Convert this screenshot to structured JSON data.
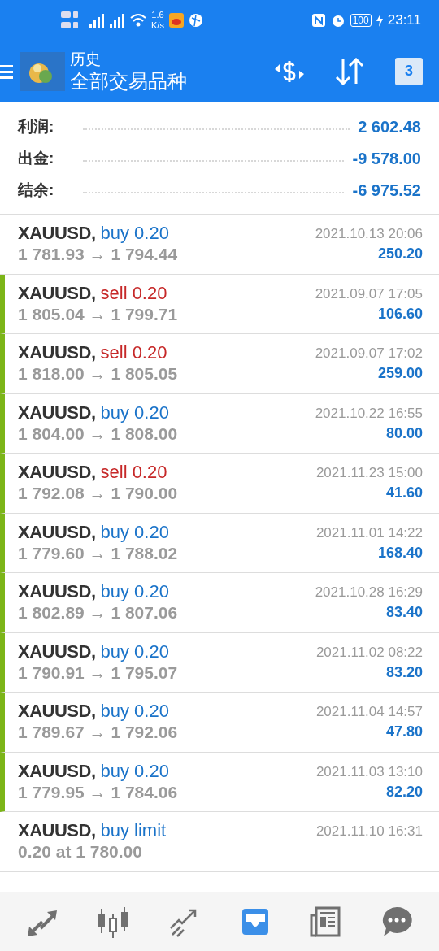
{
  "status_bar": {
    "network_speed": "1.6",
    "network_unit": "K/s",
    "battery": "100",
    "time": "23:11"
  },
  "header": {
    "title": "历史",
    "subtitle": "全部交易品种",
    "calendar_day": "3"
  },
  "summary": [
    {
      "label": "利润:",
      "value": "2 602.48"
    },
    {
      "label": "出金:",
      "value": "-9 578.00"
    },
    {
      "label": "结余:",
      "value": "-6 975.52"
    }
  ],
  "deals": [
    {
      "kind": "deal",
      "symbol": "XAUUSD,",
      "color": "#1a73c9",
      "action": "buy 0.20",
      "prices": "1 781.93 → 1 794.44",
      "time": "2021.10.13 20:06",
      "profit": "250.20",
      "marked": false
    },
    {
      "kind": "deal",
      "symbol": "XAUUSD,",
      "color": "#c62828",
      "action": "sell 0.20",
      "prices": "1 805.04 → 1 799.71",
      "time": "2021.09.07 17:05",
      "profit": "106.60",
      "marked": true
    },
    {
      "kind": "deal",
      "symbol": "XAUUSD,",
      "color": "#c62828",
      "action": "sell 0.20",
      "prices": "1 818.00 → 1 805.05",
      "time": "2021.09.07 17:02",
      "profit": "259.00",
      "marked": true
    },
    {
      "kind": "deal",
      "symbol": "XAUUSD,",
      "color": "#1a73c9",
      "action": "buy 0.20",
      "prices": "1 804.00 → 1 808.00",
      "time": "2021.10.22 16:55",
      "profit": "80.00",
      "marked": true
    },
    {
      "kind": "deal",
      "symbol": "XAUUSD,",
      "color": "#c62828",
      "action": "sell 0.20",
      "prices": "1 792.08 → 1 790.00",
      "time": "2021.11.23 15:00",
      "profit": "41.60",
      "marked": true
    },
    {
      "kind": "deal",
      "symbol": "XAUUSD,",
      "color": "#1a73c9",
      "action": "buy 0.20",
      "prices": "1 779.60 → 1 788.02",
      "time": "2021.11.01 14:22",
      "profit": "168.40",
      "marked": true
    },
    {
      "kind": "deal",
      "symbol": "XAUUSD,",
      "color": "#1a73c9",
      "action": "buy 0.20",
      "prices": "1 802.89 → 1 807.06",
      "time": "2021.10.28 16:29",
      "profit": "83.40",
      "marked": true
    },
    {
      "kind": "deal",
      "symbol": "XAUUSD,",
      "color": "#1a73c9",
      "action": "buy 0.20",
      "prices": "1 790.91 → 1 795.07",
      "time": "2021.11.02 08:22",
      "profit": "83.20",
      "marked": true
    },
    {
      "kind": "deal",
      "symbol": "XAUUSD,",
      "color": "#1a73c9",
      "action": "buy 0.20",
      "prices": "1 789.67 → 1 792.06",
      "time": "2021.11.04 14:57",
      "profit": "47.80",
      "marked": true
    },
    {
      "kind": "deal",
      "symbol": "XAUUSD,",
      "color": "#1a73c9",
      "action": "buy 0.20",
      "prices": "1 779.95 → 1 784.06",
      "time": "2021.11.03 13:10",
      "profit": "82.20",
      "marked": true
    },
    {
      "kind": "order",
      "symbol": "XAUUSD,",
      "color": "#1a73c9",
      "action": "buy limit",
      "prices": "0.20 at 1 780.00",
      "time": "2021.11.10 16:31",
      "marked": false
    }
  ],
  "nav": [
    {
      "kind": "trade",
      "selected": false
    },
    {
      "kind": "chart",
      "selected": false
    },
    {
      "kind": "trend",
      "selected": false
    },
    {
      "kind": "history",
      "selected": true
    },
    {
      "kind": "news",
      "selected": false
    },
    {
      "kind": "chat",
      "selected": false
    }
  ]
}
